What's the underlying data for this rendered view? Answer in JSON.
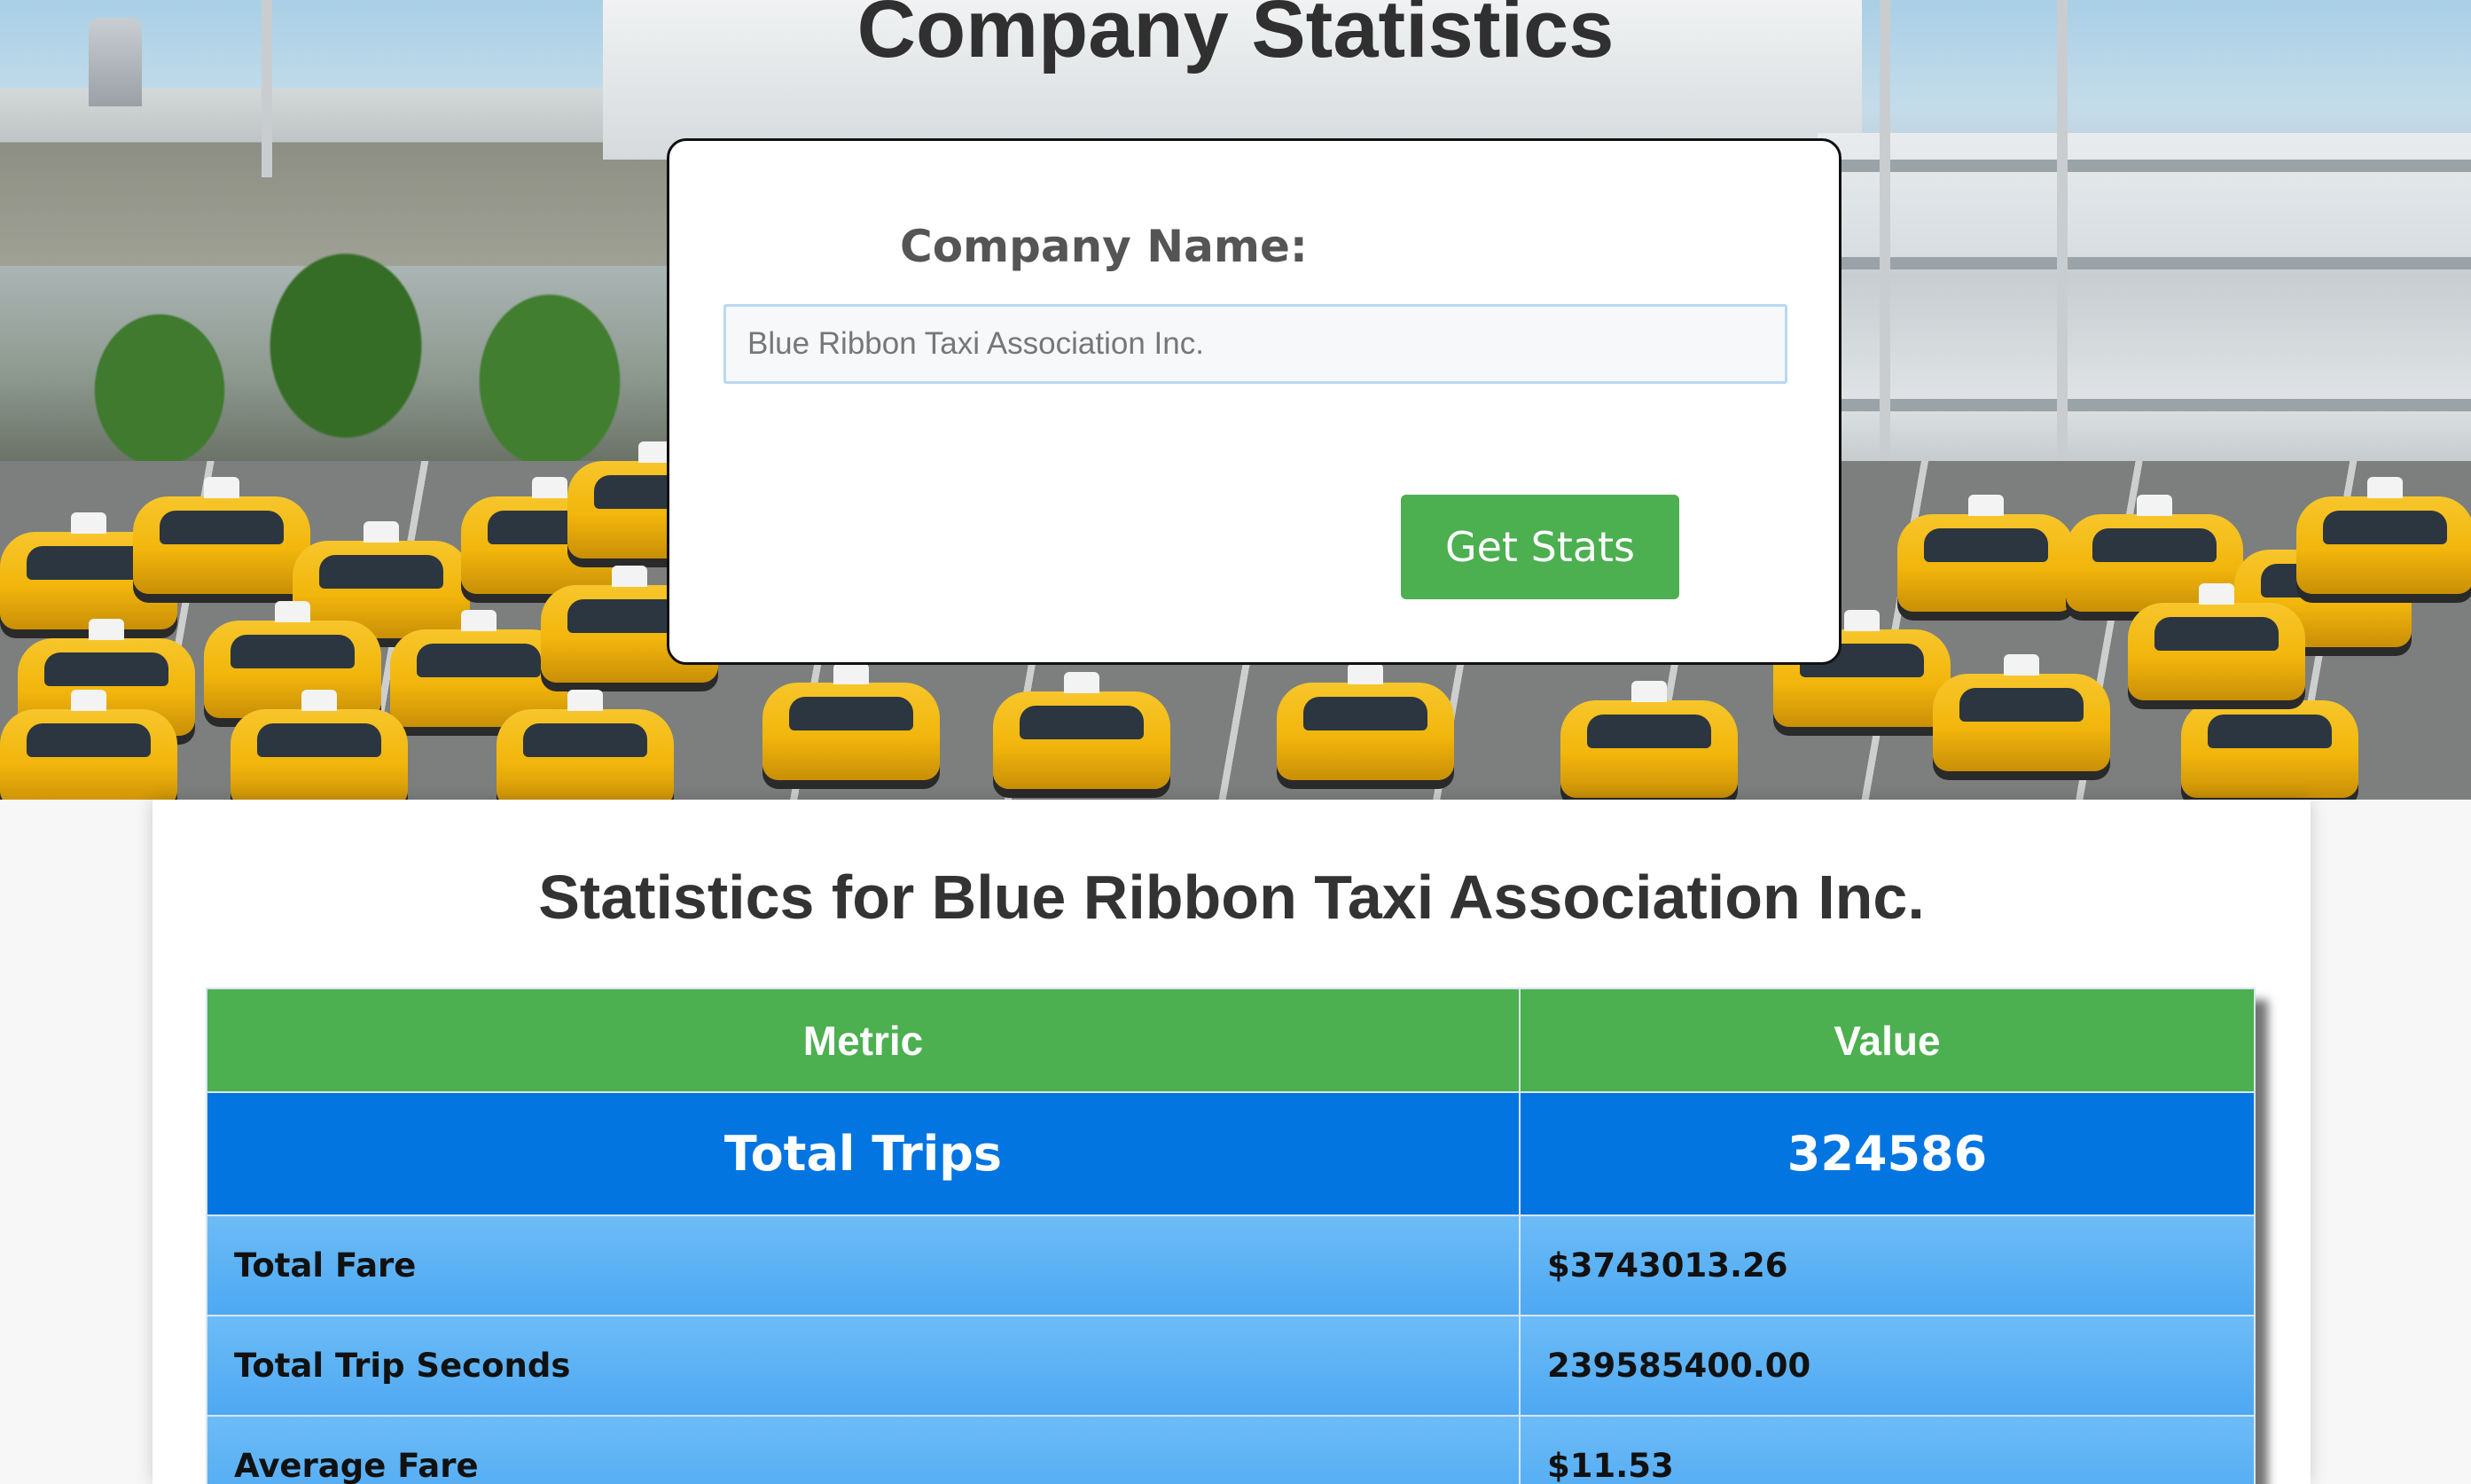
{
  "page": {
    "title": "Company Statistics"
  },
  "search": {
    "label": "Company Name:",
    "value": "Blue Ribbon Taxi Association Inc.",
    "button_label": "Get Stats",
    "button_color": "#4caf50"
  },
  "results": {
    "heading": "Statistics for Blue Ribbon Taxi Association Inc.",
    "columns": [
      "Metric",
      "Value"
    ],
    "header_color": "#4caf50",
    "highlight_color": "#0275e0",
    "row_color": "#5fb3f4",
    "rows": [
      {
        "metric": "Total Trips",
        "value": "324586"
      },
      {
        "metric": "Total Fare",
        "value": "$3743013.26"
      },
      {
        "metric": "Total Trip Seconds",
        "value": "239585400.00"
      },
      {
        "metric": "Average Fare",
        "value": "$11.53"
      }
    ]
  },
  "hero": {
    "image_name": "airport-taxi-queue-image"
  }
}
